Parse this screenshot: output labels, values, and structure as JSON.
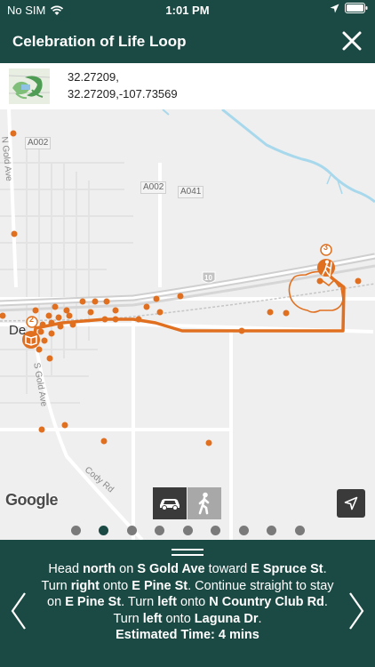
{
  "status": {
    "carrier": "No SIM",
    "time": "1:01 PM"
  },
  "header": {
    "title": "Celebration of Life Loop"
  },
  "info": {
    "coord_line1": "32.27209,",
    "coord_line2": "32.27209,-107.73569"
  },
  "map": {
    "road_labels": [
      "A002",
      "A002",
      "A041",
      "10"
    ],
    "street_labels": [
      "N Gold Ave",
      "S Gold Ave",
      "Cody Rd",
      "De"
    ],
    "markers": [
      "2",
      "3"
    ],
    "attribution": "Google"
  },
  "colors": {
    "accent": "#e07020",
    "header": "#1b4a44",
    "water": "#a8d8ec"
  },
  "icons": {
    "close": "close-icon",
    "drive": "car-icon",
    "walk": "walking-person-icon",
    "locate": "navigation-arrow-icon",
    "prev": "chevron-left-icon",
    "next": "chevron-right-icon"
  },
  "transport": {
    "selected": "drive"
  },
  "pagination": {
    "count": 9,
    "active_index": 1
  },
  "directions": {
    "segments": [
      {
        "t": "Head ",
        "b": false
      },
      {
        "t": "north",
        "b": true
      },
      {
        "t": " on ",
        "b": false
      },
      {
        "t": "S Gold Ave",
        "b": true
      },
      {
        "t": " toward ",
        "b": false
      },
      {
        "t": "E Spruce St",
        "b": true
      },
      {
        "t": ". Turn ",
        "b": false
      },
      {
        "t": "right",
        "b": true
      },
      {
        "t": " onto ",
        "b": false
      },
      {
        "t": "E Pine St",
        "b": true
      },
      {
        "t": ". Continue straight to stay on ",
        "b": false
      },
      {
        "t": "E Pine St",
        "b": true
      },
      {
        "t": ". Turn ",
        "b": false
      },
      {
        "t": "left",
        "b": true
      },
      {
        "t": " onto ",
        "b": false
      },
      {
        "t": "N Country Club Rd",
        "b": true
      },
      {
        "t": ". Turn ",
        "b": false
      },
      {
        "t": "left",
        "b": true
      },
      {
        "t": " onto ",
        "b": false
      },
      {
        "t": "Laguna Dr",
        "b": true
      },
      {
        "t": ".",
        "b": false
      }
    ],
    "estimated_time": "Estimated Time: 4 mins"
  }
}
